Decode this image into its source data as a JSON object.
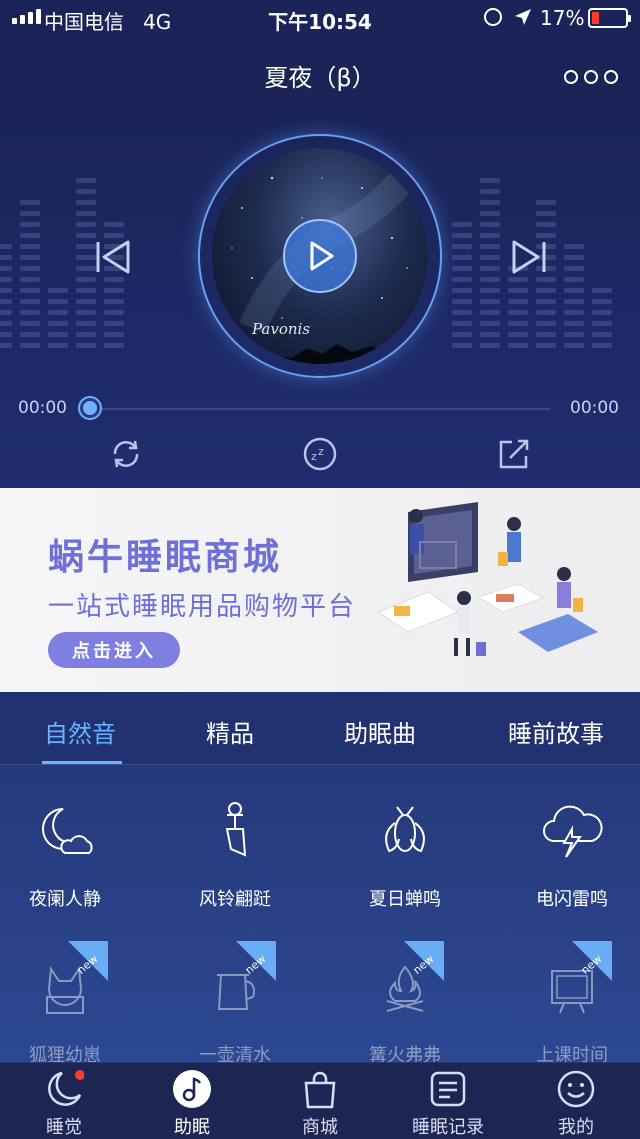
{
  "status_bar": {
    "carrier": "中国电信",
    "network": "4G",
    "time": "下午10:54",
    "battery": "17%"
  },
  "header": {
    "title": "夏夜（β）"
  },
  "player": {
    "cover_text": "Pavonis",
    "time_current": "00:00",
    "time_total": "00:00",
    "progress": 0
  },
  "banner": {
    "title": "蜗牛睡眠商城",
    "subtitle": "一站式睡眠用品购物平台",
    "button": "点击进入"
  },
  "tabs": [
    "自然音",
    "精品",
    "助眠曲",
    "睡前故事"
  ],
  "sounds": [
    {
      "label": "夜阑人静",
      "icon": "moon-cloud-icon"
    },
    {
      "label": "风铃翩跹",
      "icon": "wind-chime-icon"
    },
    {
      "label": "夏日蝉鸣",
      "icon": "cicada-icon"
    },
    {
      "label": "电闪雷鸣",
      "icon": "thunder-cloud-icon"
    }
  ],
  "sounds_new": [
    {
      "label": "狐狸幼崽",
      "icon": "fox-icon",
      "badge": "new"
    },
    {
      "label": "一壶清水",
      "icon": "kettle-icon",
      "badge": "new"
    },
    {
      "label": "篝火弗弗",
      "icon": "campfire-icon",
      "badge": "new"
    },
    {
      "label": "上课时间",
      "icon": "blackboard-icon",
      "badge": "new"
    }
  ],
  "nav": [
    {
      "label": "睡觉",
      "icon": "moon-icon"
    },
    {
      "label": "助眠",
      "icon": "music-note-icon"
    },
    {
      "label": "商城",
      "icon": "shopping-bag-icon"
    },
    {
      "label": "睡眠记录",
      "icon": "record-icon"
    },
    {
      "label": "我的",
      "icon": "smile-icon"
    }
  ],
  "colors": {
    "accent": "#66b4ff",
    "banner_purple": "#6e70d8",
    "badge_red": "#ff3b30"
  }
}
